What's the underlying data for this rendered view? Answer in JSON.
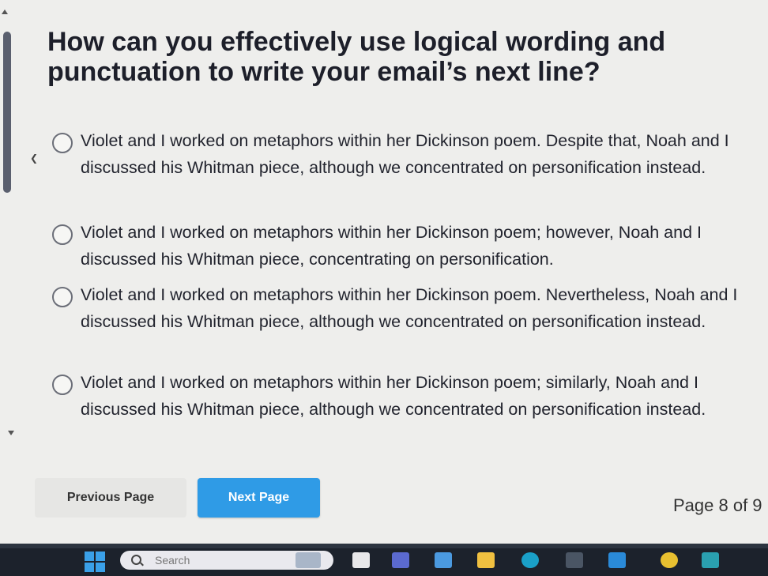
{
  "question": "How can you effectively use logical wording and punctuation to write your email’s next line?",
  "options": [
    {
      "text": "Violet and I worked on metaphors within her Dickinson poem. Despite that, Noah and I discussed his Whitman piece, although we concentrated on personification instead."
    },
    {
      "text": "Violet and I worked on metaphors within her Dickinson poem; however, Noah and I discussed his Whitman piece, concentrating on personification."
    },
    {
      "text": "Violet and I worked on metaphors within her Dickinson poem. Nevertheless, Noah and I discussed his Whitman piece, although we concentrated on personification instead."
    },
    {
      "text": "Violet and I worked on metaphors within her Dickinson poem; similarly, Noah and I discussed his Whitman piece, although we concentrated on personification instead."
    }
  ],
  "nav": {
    "previous_label": "Previous Page",
    "next_label": "Next Page",
    "page_indicator": "Page 8 of 9"
  },
  "taskbar": {
    "search_placeholder": "Search",
    "icons": [
      "start-icon",
      "search-icon",
      "widget-icon",
      "file-icon",
      "teams-icon",
      "chat-icon",
      "folder-icon",
      "edge-icon",
      "store-icon",
      "mail-icon",
      "chrome-icon",
      "app-icon"
    ]
  },
  "colors": {
    "accent": "#2f9be6",
    "text": "#1f1f24",
    "background": "#eeeeec",
    "taskbar": "#1c222c"
  }
}
